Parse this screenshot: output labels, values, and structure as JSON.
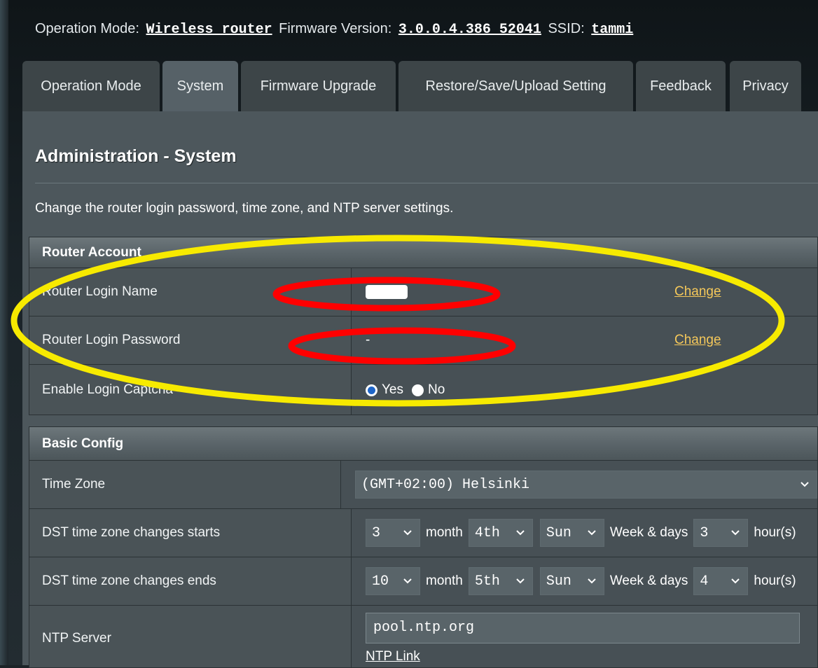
{
  "status_bar": {
    "op_mode_label": "Operation Mode:",
    "op_mode_value": "Wireless router",
    "firmware_label": "Firmware Version:",
    "firmware_value": "3.0.0.4.386_52041",
    "ssid_label": "SSID:",
    "ssid_value": "tammi"
  },
  "tabs": [
    {
      "label": "Operation Mode",
      "active": false
    },
    {
      "label": "System",
      "active": true
    },
    {
      "label": "Firmware Upgrade",
      "active": false
    },
    {
      "label": "Restore/Save/Upload Setting",
      "active": false
    },
    {
      "label": "Feedback",
      "active": false
    },
    {
      "label": "Privacy",
      "active": false
    }
  ],
  "page": {
    "title": "Administration - System",
    "description": "Change the router login password, time zone, and NTP server settings."
  },
  "router_account": {
    "header": "Router Account",
    "login_name_label": "Router Login Name",
    "login_password_label": "Router Login Password",
    "login_password_value": "-",
    "change_label": "Change",
    "captcha_label": "Enable Login Captcha",
    "yes_label": "Yes",
    "no_label": "No",
    "captcha_selected": "Yes"
  },
  "basic_config": {
    "header": "Basic Config",
    "time_zone_label": "Time Zone",
    "time_zone_value": "(GMT+02:00) Helsinki",
    "dst_start_label": "DST time zone changes starts",
    "dst_end_label": "DST time zone changes ends",
    "dst_start": {
      "month": "3",
      "week": "4th",
      "day": "Sun",
      "hour": "3"
    },
    "dst_end": {
      "month": "10",
      "week": "5th",
      "day": "Sun",
      "hour": "4"
    },
    "month_word": "month",
    "week_days_word": "Week & days",
    "hours_word": "hour(s)",
    "ntp_label": "NTP Server",
    "ntp_value": "pool.ntp.org",
    "ntp_link": "NTP Link"
  },
  "colors": {
    "annotation_yellow": "#f7ea00",
    "annotation_red": "#ff0000",
    "link_yellow": "#f5c85a"
  }
}
